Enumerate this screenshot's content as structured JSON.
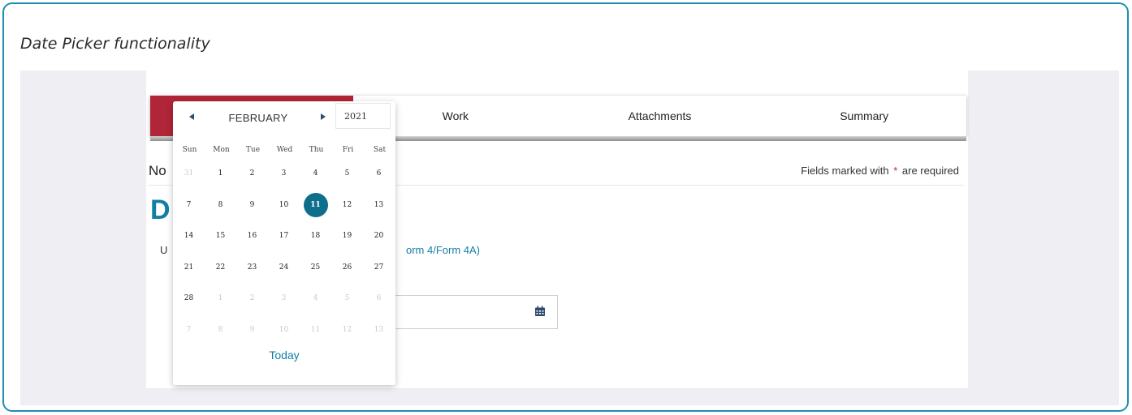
{
  "caption": "Date Picker functionality",
  "tabs": {
    "items": [
      "Work",
      "Attachments",
      "Summary"
    ]
  },
  "form": {
    "notice_fragment": "No",
    "required_note_prefix": "Fields marked with",
    "required_star": "*",
    "required_note_suffix": "are required",
    "heading_fragment": "D",
    "u_fragment": "U",
    "form_link": "orm 4/Form 4A)",
    "date_value": "",
    "calendar_icon": "calendar-icon"
  },
  "datepicker": {
    "month": "FEBRUARY",
    "year": "2021",
    "weekdays": [
      "Sun",
      "Mon",
      "Tue",
      "Wed",
      "Thu",
      "Fri",
      "Sat"
    ],
    "weeks": [
      [
        {
          "d": "31",
          "m": true
        },
        {
          "d": "1"
        },
        {
          "d": "2"
        },
        {
          "d": "3"
        },
        {
          "d": "4"
        },
        {
          "d": "5"
        },
        {
          "d": "6"
        }
      ],
      [
        {
          "d": "7"
        },
        {
          "d": "8"
        },
        {
          "d": "9"
        },
        {
          "d": "10"
        },
        {
          "d": "11",
          "s": true
        },
        {
          "d": "12"
        },
        {
          "d": "13"
        }
      ],
      [
        {
          "d": "14"
        },
        {
          "d": "15"
        },
        {
          "d": "16"
        },
        {
          "d": "17"
        },
        {
          "d": "18"
        },
        {
          "d": "19"
        },
        {
          "d": "20"
        }
      ],
      [
        {
          "d": "21"
        },
        {
          "d": "22"
        },
        {
          "d": "23"
        },
        {
          "d": "24"
        },
        {
          "d": "25"
        },
        {
          "d": "26"
        },
        {
          "d": "27"
        }
      ],
      [
        {
          "d": "28"
        },
        {
          "d": "1",
          "m": true
        },
        {
          "d": "2",
          "m": true
        },
        {
          "d": "3",
          "m": true
        },
        {
          "d": "4",
          "m": true
        },
        {
          "d": "5",
          "m": true
        },
        {
          "d": "6",
          "m": true
        }
      ],
      [
        {
          "d": "7",
          "m": true
        },
        {
          "d": "8",
          "m": true
        },
        {
          "d": "9",
          "m": true
        },
        {
          "d": "10",
          "m": true
        },
        {
          "d": "11",
          "m": true
        },
        {
          "d": "12",
          "m": true
        },
        {
          "d": "13",
          "m": true
        }
      ]
    ],
    "selected_day": "11",
    "today_label": "Today",
    "prev_icon": "triangle-left-icon",
    "next_icon": "triangle-right-icon"
  },
  "colors": {
    "accent": "#137fa4",
    "active_tab": "#b02537",
    "selected_day": "#0e6f8d",
    "frame_border": "#1a8fb3"
  }
}
